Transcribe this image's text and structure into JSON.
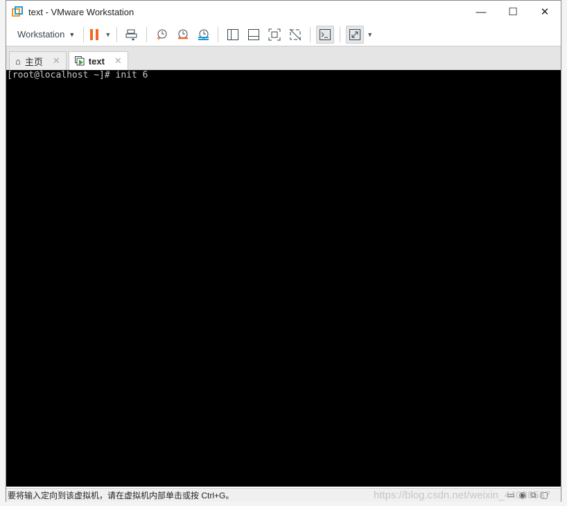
{
  "window": {
    "title": "text - VMware Workstation",
    "controls": {
      "minimize": "—",
      "maximize": "☐",
      "close": "✕"
    }
  },
  "toolbar": {
    "workstation_menu": "Workstation",
    "icons": [
      "pause-icon",
      "send-ctrl-alt-del-icon",
      "snapshot-take-icon",
      "snapshot-revert-icon",
      "snapshot-manager-icon",
      "sidebar-view-icon",
      "thumbnail-view-icon",
      "fullscreen-icon",
      "unity-icon",
      "console-view-icon",
      "stretch-icon"
    ]
  },
  "tabs": [
    {
      "label": "主页",
      "close": "✕"
    },
    {
      "label": "text",
      "close": "✕"
    }
  ],
  "console": {
    "text": "[root@localhost ~]# init 6"
  },
  "status": {
    "message": "要将输入定向到该虚拟机，请在虚拟机内部单击或按 Ctrl+G。",
    "watermark": "https://blog.csdn.net/weixin_44088587"
  },
  "colors": {
    "pause": "#f26522",
    "revert": "#f26522",
    "manager": "#1a9ad6",
    "run": "#3aa935"
  }
}
